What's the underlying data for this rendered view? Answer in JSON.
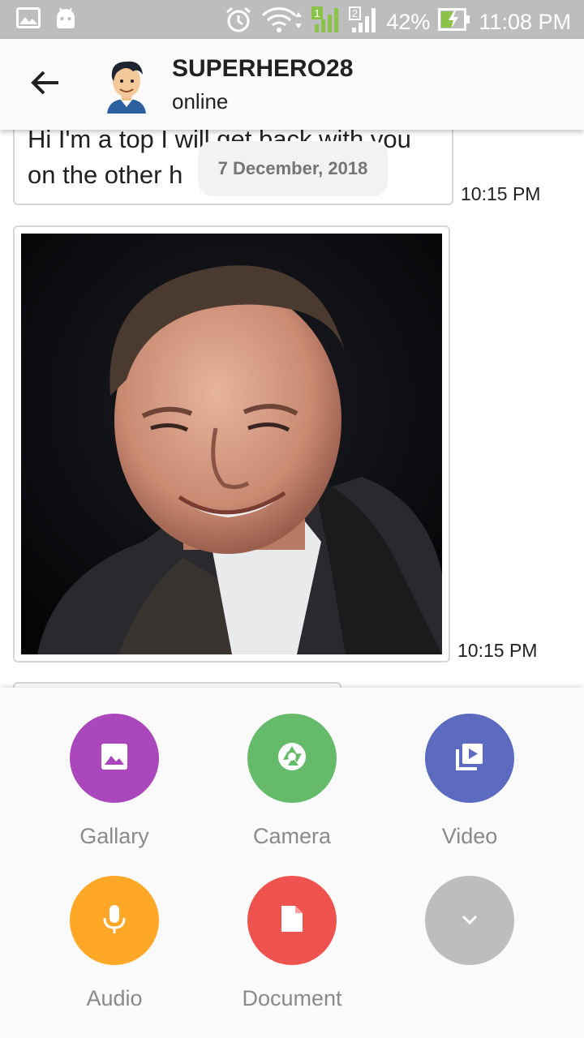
{
  "status_bar": {
    "battery_percent": "42%",
    "time": "11:08 PM",
    "sim1_label": "1",
    "sim2_label": "2",
    "icons": [
      "gallery-notification-icon",
      "android-icon",
      "alarm-icon",
      "wifi-icon",
      "signal-sim1-icon",
      "signal-sim2-icon",
      "battery-charging-icon"
    ]
  },
  "header": {
    "contact_name": "SUPERHERO28",
    "contact_status": "online",
    "icons": [
      "back-arrow-icon",
      "avatar"
    ]
  },
  "chat": {
    "text_message": {
      "line1": "Hi I'm a top I will get back with you",
      "line2": "on the other h",
      "time": "10:15 PM"
    },
    "date_chip": "7 December, 2018",
    "image_message": {
      "time": "10:15 PM"
    }
  },
  "attachment_sheet": {
    "options": [
      {
        "label": "Gallary",
        "icon": "image-icon",
        "color": "#AB47BC"
      },
      {
        "label": "Camera",
        "icon": "camera-shutter-icon",
        "color": "#66BB6A"
      },
      {
        "label": "Video",
        "icon": "video-library-icon",
        "color": "#5C6BC0"
      },
      {
        "label": "Audio",
        "icon": "microphone-icon",
        "color": "#FFA726"
      },
      {
        "label": "Document",
        "icon": "document-icon",
        "color": "#EF5350"
      },
      {
        "label": "",
        "icon": "chevron-down-icon",
        "color": "#BDBDBD"
      }
    ]
  }
}
